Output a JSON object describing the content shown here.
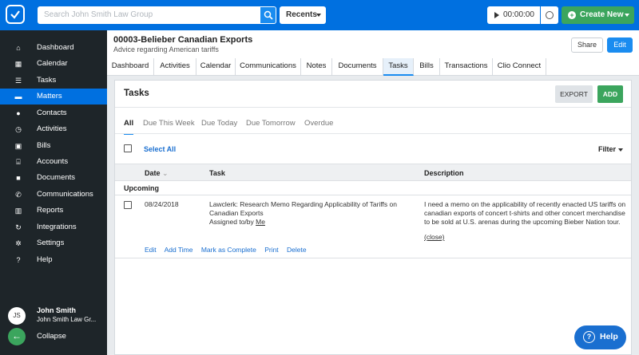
{
  "topbar": {
    "search_placeholder": "Search John Smith Law Group",
    "recents_label": "Recents",
    "timer_value": "00:00:00",
    "create_new_label": "Create New"
  },
  "sidebar": {
    "items": [
      {
        "label": "Dashboard",
        "icon": "home-icon"
      },
      {
        "label": "Calendar",
        "icon": "calendar-icon"
      },
      {
        "label": "Tasks",
        "icon": "list-icon"
      },
      {
        "label": "Matters",
        "icon": "briefcase-icon"
      },
      {
        "label": "Contacts",
        "icon": "person-icon"
      },
      {
        "label": "Activities",
        "icon": "clock-icon"
      },
      {
        "label": "Bills",
        "icon": "bill-icon"
      },
      {
        "label": "Accounts",
        "icon": "bank-icon"
      },
      {
        "label": "Documents",
        "icon": "folder-icon"
      },
      {
        "label": "Communications",
        "icon": "phone-icon"
      },
      {
        "label": "Reports",
        "icon": "bar-chart-icon"
      },
      {
        "label": "Integrations",
        "icon": "refresh-icon"
      },
      {
        "label": "Settings",
        "icon": "gear-icon"
      },
      {
        "label": "Help",
        "icon": "question-icon"
      }
    ],
    "active": "Matters",
    "user": {
      "initials": "JS",
      "name": "John Smith",
      "firm": "John Smith Law Gr..."
    },
    "collapse_label": "Collapse"
  },
  "matter": {
    "title": "00003-Belieber Canadian Exports",
    "description": "Advice regarding American tariffs",
    "share_label": "Share",
    "edit_label": "Edit",
    "tabs": [
      "Dashboard",
      "Activities",
      "Calendar",
      "Communications",
      "Notes",
      "Documents",
      "Tasks",
      "Bills",
      "Transactions",
      "Clio Connect"
    ],
    "active_tab": "Tasks"
  },
  "tasks_panel": {
    "title": "Tasks",
    "export_label": "EXPORT",
    "add_label": "ADD",
    "filters": [
      "All",
      "Due This Week",
      "Due Today",
      "Due Tomorrow",
      "Overdue"
    ],
    "active_filter": "All",
    "select_all_label": "Select All",
    "filter_label": "Filter",
    "columns": {
      "date": "Date",
      "task": "Task",
      "description": "Description"
    },
    "group": "Upcoming",
    "rows": [
      {
        "date": "08/24/2018",
        "task": "Lawclerk: Research Memo Regarding Applicability of Tariffs on Canadian Exports",
        "assigned_prefix": "Assigned to/by",
        "assigned_to": "Me",
        "description": "I need a memo on the applicability of recently enacted US tariffs on canadian exports of concert t-shirts and other concert merchandise to be sold at U.S. arenas during the upcoming Bieber Nation tour.",
        "close_label": "(close)",
        "actions": [
          "Edit",
          "Add Time",
          "Mark as Complete",
          "Print",
          "Delete"
        ]
      }
    ]
  },
  "help_label": "Help",
  "colors": {
    "primary": "#0070e0",
    "green": "#3ba55d",
    "sidebar": "#1e2529"
  }
}
